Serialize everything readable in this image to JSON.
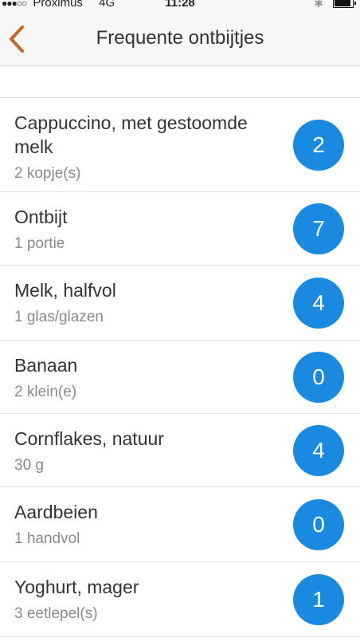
{
  "status_bar": {
    "signal": "●●●○○",
    "carrier": "Proximus",
    "network": "4G",
    "time": "11:28",
    "bluetooth_icon": "bluetooth-icon",
    "battery_icon": "battery-icon"
  },
  "nav": {
    "back_icon": "chevron-left-icon",
    "title": "Frequente ontbijtjes",
    "accent_color": "#c8661f"
  },
  "badge_color": "#1a8ae0",
  "items": [
    {
      "name": "Cappuccino, met gestoomde melk",
      "portion": "2 kopje(s)",
      "count": "2"
    },
    {
      "name": "Ontbijt",
      "portion": "1 portie",
      "count": "7"
    },
    {
      "name": "Melk, halfvol",
      "portion": "1 glas/glazen",
      "count": "4"
    },
    {
      "name": "Banaan",
      "portion": "2 klein(e)",
      "count": "0"
    },
    {
      "name": "Cornflakes, natuur",
      "portion": "30 g",
      "count": "4"
    },
    {
      "name": "Aardbeien",
      "portion": "1 handvol",
      "count": "0"
    },
    {
      "name": "Yoghurt, mager",
      "portion": "3 eetlepel(s)",
      "count": "1"
    }
  ]
}
